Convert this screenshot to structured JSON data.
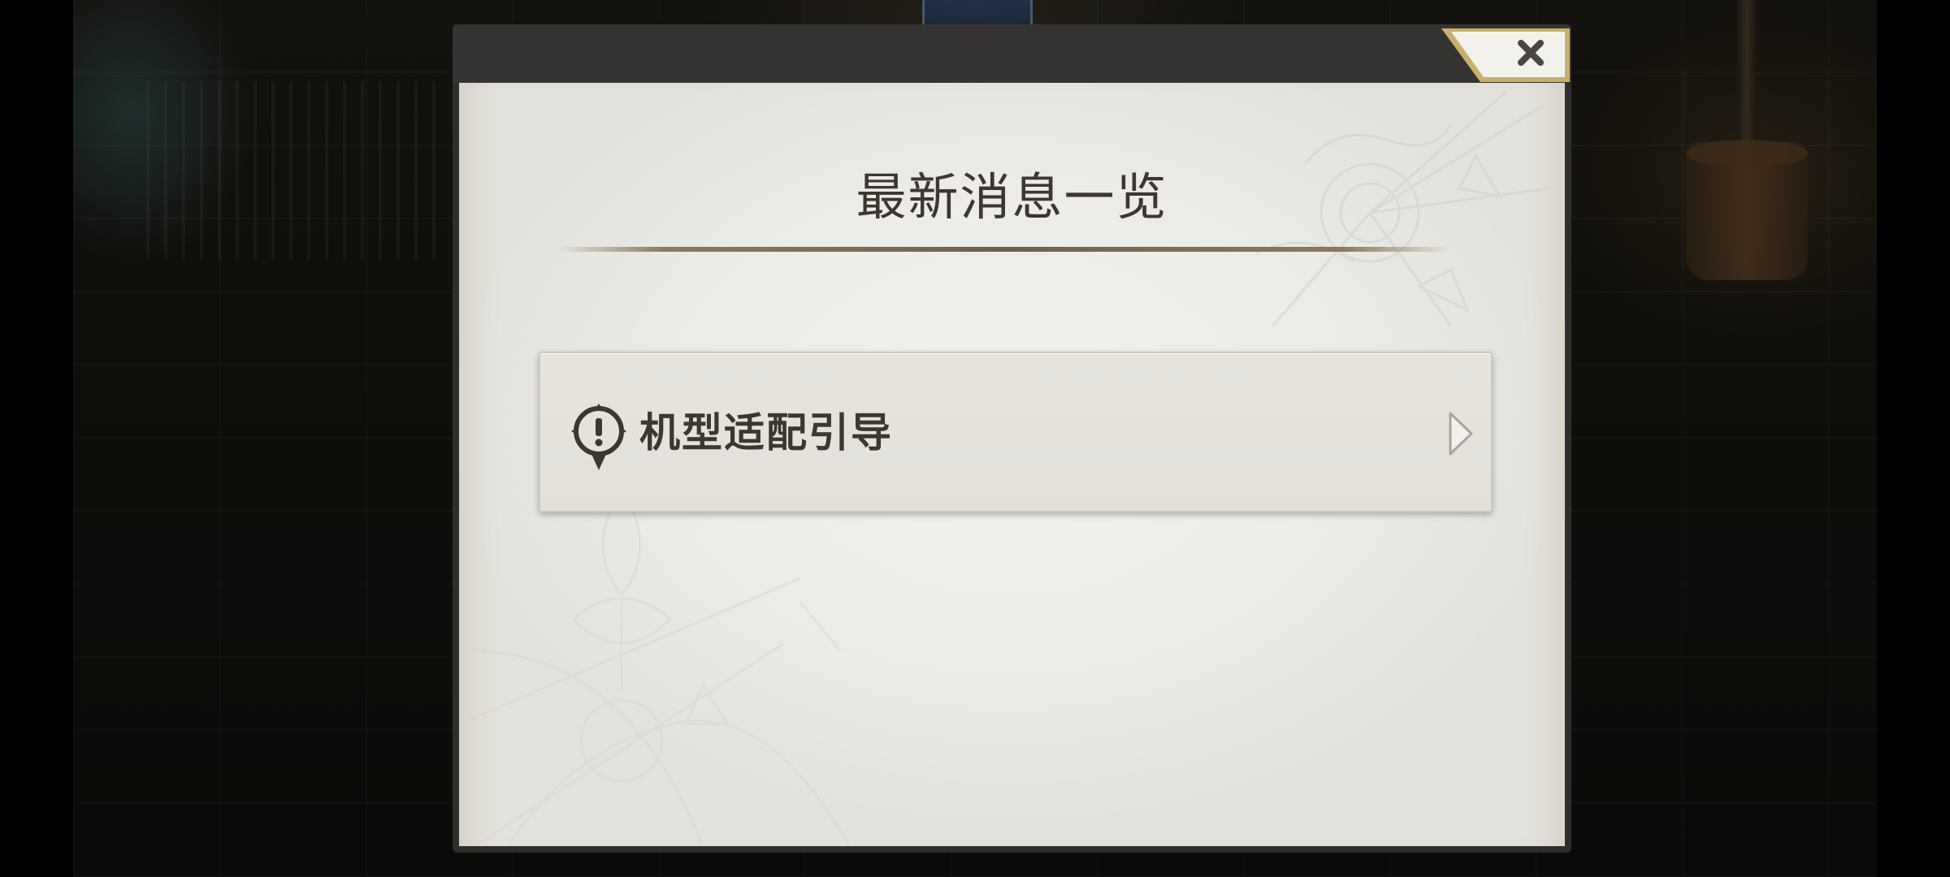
{
  "dialog": {
    "title": "最新消息一览",
    "close_icon": "close-icon"
  },
  "news": {
    "items": [
      {
        "label": "机型适配引导",
        "icon": "alert-icon",
        "arrow_icon": "chevron-right-icon"
      }
    ]
  },
  "colors": {
    "paper": "#ecebe7",
    "frame": "#353433",
    "text": "#3d3631",
    "accent_gold": "#c8b06a"
  }
}
